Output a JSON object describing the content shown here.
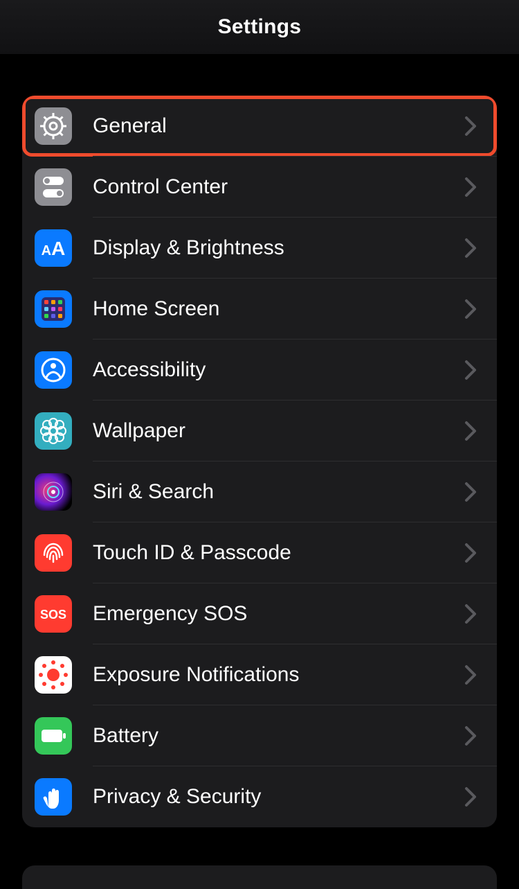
{
  "header": {
    "title": "Settings"
  },
  "rows": [
    {
      "name": "general",
      "label": "General",
      "icon": "gear-icon",
      "bg": "bg-gray",
      "highlight": true
    },
    {
      "name": "control-center",
      "label": "Control Center",
      "icon": "toggles-icon",
      "bg": "bg-gray2",
      "highlight": false
    },
    {
      "name": "display-brightness",
      "label": "Display & Brightness",
      "icon": "aa-icon",
      "bg": "bg-blue",
      "highlight": false
    },
    {
      "name": "home-screen",
      "label": "Home Screen",
      "icon": "grid-icon",
      "bg": "bg-blue",
      "highlight": false
    },
    {
      "name": "accessibility",
      "label": "Accessibility",
      "icon": "person-circle-icon",
      "bg": "bg-blue",
      "highlight": false
    },
    {
      "name": "wallpaper",
      "label": "Wallpaper",
      "icon": "flower-icon",
      "bg": "bg-teal",
      "highlight": false
    },
    {
      "name": "siri-search",
      "label": "Siri & Search",
      "icon": "siri-icon",
      "bg": "bg-siri",
      "highlight": false
    },
    {
      "name": "touch-id-passcode",
      "label": "Touch ID & Passcode",
      "icon": "fingerprint-icon",
      "bg": "bg-red",
      "highlight": false
    },
    {
      "name": "emergency-sos",
      "label": "Emergency SOS",
      "icon": "sos-icon",
      "bg": "bg-sosred",
      "highlight": false
    },
    {
      "name": "exposure-notifications",
      "label": "Exposure Notifications",
      "icon": "exposure-icon",
      "bg": "bg-white",
      "highlight": false
    },
    {
      "name": "battery",
      "label": "Battery",
      "icon": "battery-icon",
      "bg": "bg-green",
      "highlight": false
    },
    {
      "name": "privacy-security",
      "label": "Privacy & Security",
      "icon": "hand-icon",
      "bg": "bg-blue",
      "highlight": false
    }
  ]
}
